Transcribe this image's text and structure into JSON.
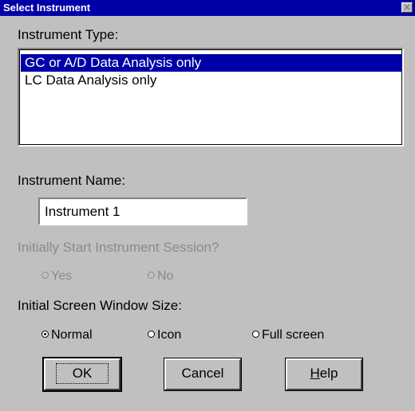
{
  "window": {
    "title": "Select Instrument",
    "close_symbol": "✕"
  },
  "instrument_type": {
    "label": "Instrument Type:",
    "items": [
      {
        "label": "GC or A/D Data Analysis only",
        "selected": true
      },
      {
        "label": "LC Data Analysis only",
        "selected": false
      }
    ]
  },
  "instrument_name": {
    "label": "Instrument Name:",
    "value": "Instrument 1"
  },
  "start_session": {
    "label": "Initially Start Instrument Session?",
    "options": [
      {
        "label": "Yes",
        "checked": false,
        "enabled": false
      },
      {
        "label": "No",
        "checked": false,
        "enabled": false
      }
    ]
  },
  "window_size": {
    "label": "Initial Screen Window Size:",
    "options": [
      {
        "label": "Normal",
        "checked": true
      },
      {
        "label": "Icon",
        "checked": false
      },
      {
        "label": "Full screen",
        "checked": false
      }
    ]
  },
  "buttons": {
    "ok": "OK",
    "cancel": "Cancel",
    "help_underlined": "H",
    "help_rest": "elp"
  },
  "colors": {
    "title_bar": "#0000a8",
    "face": "#c0c0c0",
    "selection": "#0000a8",
    "disabled_text": "#8a8a8a"
  }
}
